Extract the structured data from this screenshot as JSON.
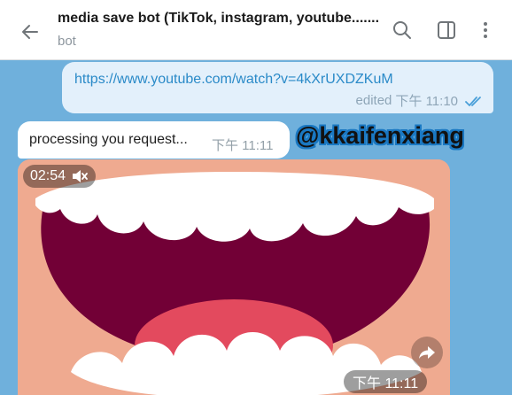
{
  "header": {
    "title": "media save bot (TikTok, instagram, youtube.......",
    "subtitle": "bot",
    "icons": [
      "back-arrow-icon",
      "search-icon",
      "sidebar-toggle-icon",
      "more-vertical-icon"
    ]
  },
  "messages": {
    "outgoing": {
      "link": "https://www.youtube.com/watch?v=4kXrUXDZKuM",
      "status": "edited",
      "time": "下午 11:10",
      "read_icon": "double-check-icon"
    },
    "incoming": {
      "text": "processing you request...",
      "time": "下午 11:11"
    },
    "video": {
      "duration": "02:54",
      "mute_icon": "muted-speaker-icon",
      "time": "下午 11:11",
      "forward_icon": "forward-arrow-icon"
    }
  },
  "watermark": "@kkaifenxiang",
  "colors": {
    "chat_background": "#6fb0dc",
    "outgoing_bubble": "#e3f0fb",
    "link": "#2a8ac8",
    "header_icon": "#707579",
    "skin": "#efaa90",
    "mouth": "#720036",
    "tongue": "#e34a5e",
    "teeth": "#ffffff"
  }
}
